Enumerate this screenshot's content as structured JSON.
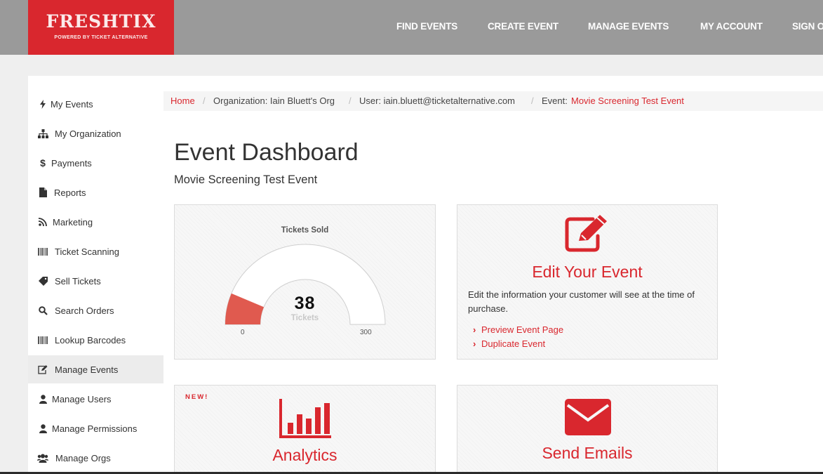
{
  "brand": {
    "name": "FRESHTIX",
    "tagline": "POWERED BY TICKET ALTERNATIVE",
    "color": "#d9272e"
  },
  "topnav": [
    {
      "label": "FIND EVENTS"
    },
    {
      "label": "CREATE EVENT"
    },
    {
      "label": "MANAGE EVENTS"
    },
    {
      "label": "MY ACCOUNT"
    },
    {
      "label": "SIGN OUT"
    }
  ],
  "sidebar": {
    "items": [
      {
        "label": "My Events",
        "icon": "bolt-icon"
      },
      {
        "label": "My Organization",
        "icon": "sitemap-icon"
      },
      {
        "label": "Payments",
        "icon": "dollar-icon"
      },
      {
        "label": "Reports",
        "icon": "file-icon"
      },
      {
        "label": "Marketing",
        "icon": "rss-icon"
      },
      {
        "label": "Ticket Scanning",
        "icon": "barcode-icon"
      },
      {
        "label": "Sell Tickets",
        "icon": "ticket-icon"
      },
      {
        "label": "Search Orders",
        "icon": "search-icon"
      },
      {
        "label": "Lookup Barcodes",
        "icon": "barcode-icon"
      },
      {
        "label": "Manage Events",
        "icon": "edit-icon",
        "active": true
      },
      {
        "label": "Manage Users",
        "icon": "user-icon"
      },
      {
        "label": "Manage Permissions",
        "icon": "user-icon"
      },
      {
        "label": "Manage Orgs",
        "icon": "users-icon"
      }
    ]
  },
  "breadcrumb": {
    "home": "Home",
    "separator": "/",
    "organization": "Organization: Iain Bluett's Org",
    "user": "User: iain.bluett@ticketalternative.com",
    "event_prefix": "Event:",
    "event_name": "Movie Screening Test Event"
  },
  "page": {
    "title": "Event Dashboard",
    "subtitle": "Movie Screening Test Event"
  },
  "tickets_gauge": {
    "title": "Tickets Sold",
    "value": 38,
    "value_text": "38",
    "unit": "Tickets",
    "min": 0,
    "max": 300,
    "min_label": "0",
    "max_label": "300",
    "fill_color": "#e05a4f"
  },
  "edit_card": {
    "icon": "edit-icon",
    "title": "Edit Your Event",
    "description": "Edit the information your customer will see at the time of purchase.",
    "links": [
      {
        "label": "Preview Event Page"
      },
      {
        "label": "Duplicate Event"
      }
    ]
  },
  "analytics_card": {
    "badge": "NEW!",
    "icon": "bar-chart-icon",
    "title": "Analytics"
  },
  "emails_card": {
    "icon": "envelope-icon",
    "title": "Send Emails"
  }
}
